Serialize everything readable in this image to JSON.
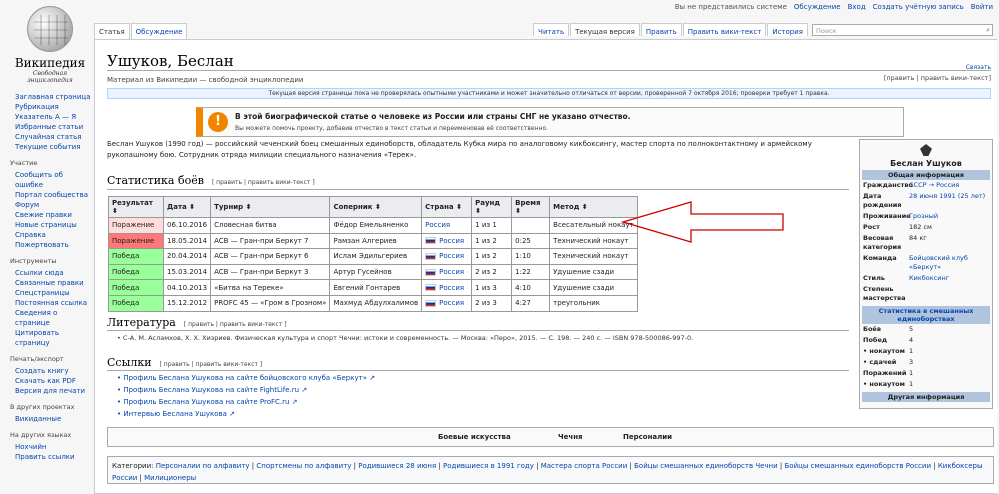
{
  "personal": [
    "Вы не представились системе",
    "Обсуждение",
    "Вход",
    "Создать учётную запись",
    "Войти"
  ],
  "logo": {
    "title": "Википедия",
    "subtitle": "Свободная энциклопедия"
  },
  "sidebar": [
    {
      "head": "",
      "items": [
        "Заглавная страница",
        "Рубрикация",
        "Указатель А — Я",
        "Избранные статьи",
        "Случайная статья",
        "Текущие события"
      ]
    },
    {
      "head": "Участие",
      "items": [
        "Сообщить об ошибке",
        "Портал сообщества",
        "Форум",
        "Свежие правки",
        "Новые страницы",
        "Справка",
        "Пожертвовать"
      ]
    },
    {
      "head": "Инструменты",
      "items": [
        "Ссылки сюда",
        "Связанные правки",
        "Спецстраницы",
        "Постоянная ссылка",
        "Сведения о странице",
        "Цитировать страницу"
      ]
    },
    {
      "head": "Печать/экспорт",
      "items": [
        "Создать книгу",
        "Скачать как PDF",
        "Версия для печати"
      ]
    },
    {
      "head": "В других проектах",
      "items": [
        "Викиданные"
      ]
    },
    {
      "head": "На других языках",
      "items": [
        "Нохчийн",
        "Править ссылки"
      ]
    }
  ],
  "tabs_left": [
    "Статья",
    "Обсуждение"
  ],
  "tabs_right": [
    "Читать",
    "Текущая версия",
    "Править",
    "Править вики-текст",
    "История"
  ],
  "search_placeholder": "Поиск",
  "page": {
    "title": "Ушуков, Беслан",
    "watch": "Связать",
    "from": "Материал из Википедии — свободной энциклопедии",
    "edit_links": "[править | править вики-текст]",
    "rev_notice": "Текущая версия страницы пока не проверялась опытными участниками и может значительно отличаться от версии, проверенной 7 октября 2016; проверки требует 1 правка.",
    "ambox_title": "В этой биографической статье о человеке из России или страны СНГ не указано отчество.",
    "ambox_text": "Вы можете помочь проекту, добавив отчество в текст статьи и переименовав её соответственно.",
    "lead": "Беслан Ушуков (1990 год) — российский чеченский боец смешанных единоборств, обладатель Кубка мира по аналоговому кикбоксингу, мастер спорта по полноконтактному и армейскому рукопашному бою. Сотрудник отряда милиции специального назначения «Терек»."
  },
  "sections": {
    "stats": "Статистика боёв",
    "lit": "Литература",
    "links": "Ссылки",
    "edit": "[ править | править вики-текст ]"
  },
  "fights": {
    "headers": [
      "Результат",
      "Дата",
      "Турнир",
      "Соперник",
      "Страна",
      "Раунд",
      "Время",
      "Метод"
    ],
    "rows": [
      {
        "res": "Поражение",
        "date": "06.10.2016",
        "event": "Словесная битва",
        "opp": "Фёдор Емельяненко",
        "country": "Россия",
        "round": "1 из 1",
        "time": "",
        "method": "Всесательный нокаут",
        "cls": "res-loss",
        "flag": false
      },
      {
        "res": "Поражение",
        "date": "18.05.2014",
        "event": "ACB — Гран-при Беркут 7",
        "opp": "Рамзан Алгериев",
        "country": "Россия",
        "round": "1 из 2",
        "time": "0:25",
        "method": "Технический нокаут",
        "cls": "res-loss-red",
        "flag": true
      },
      {
        "res": "Победа",
        "date": "20.04.2014",
        "event": "ACB — Гран-при Беркут 6",
        "opp": "Ислам Эдильгериев",
        "country": "Россия",
        "round": "1 из 2",
        "time": "1:10",
        "method": "Технический нокаут",
        "cls": "res-win",
        "flag": true
      },
      {
        "res": "Победа",
        "date": "15.03.2014",
        "event": "ACB — Гран-при Беркут 3",
        "opp": "Артур Гусейнов",
        "country": "Россия",
        "round": "2 из 2",
        "time": "1:22",
        "method": "Удушение сзади",
        "cls": "res-win",
        "flag": true
      },
      {
        "res": "Победа",
        "date": "04.10.2013",
        "event": "«Битва на Тереке»",
        "opp": "Евгений Гонтарев",
        "country": "Россия",
        "round": "1 из 3",
        "time": "4:10",
        "method": "Удушение сзади",
        "cls": "res-win",
        "flag": true
      },
      {
        "res": "Победа",
        "date": "15.12.2012",
        "event": "PROFC 45 — «Гром в Грозном»",
        "opp": "Махмуд Абдулхалимов",
        "country": "Россия",
        "round": "2 из 3",
        "time": "4:27",
        "method": "треугольник",
        "cls": "res-win",
        "flag": true
      }
    ]
  },
  "literature": "• С-А. М. Асламхов, Х. Х. Хизриев. Физическая культура и спорт Чечни: истоки и современность. — Москва: «Перо», 2015. — С. 198. — 240 с. — ISBN 978-500086-997-0.",
  "links": [
    "Профиль Беслана Ушукова на сайте бойцовского клуба «Беркут»",
    "Профиль Беслана Ушукова на сайте FightLife.ru",
    "Профиль Беслана Ушукова на сайте ProFC.ru",
    "Интервью Беслана Ушукова"
  ],
  "navbox": [
    "Боевые искусства",
    "Чечня",
    "Персоналии"
  ],
  "categories_label": "Категории:",
  "categories": [
    "Персоналии по алфавиту",
    "Спортсмены по алфавиту",
    "Родившиеся 28 июня",
    "Родившиеся в 1991 году",
    "Мастера спорта России",
    "Бойцы смешанных единоборств Чечни",
    "Бойцы смешанных единоборств России",
    "Кикбоксеры России",
    "Милиционеры"
  ],
  "infobox": {
    "name": "Беслан Ушуков",
    "general": "Общая информация",
    "rows": [
      {
        "k": "Гражданство",
        "v": "СССР → Россия",
        "link": true
      },
      {
        "k": "Дата рождения",
        "v": "28 июня 1991 (25 лет)",
        "link": true
      },
      {
        "k": "Проживание",
        "v": "Грозный",
        "link": true
      },
      {
        "k": "Рост",
        "v": "182 см",
        "link": false
      },
      {
        "k": "Весовая категория",
        "v": "84 кг",
        "link": false
      },
      {
        "k": "Команда",
        "v": "Бойцовский клуб «Беркут»",
        "link": true
      },
      {
        "k": "Стиль",
        "v": "Кикбоксинг",
        "link": true
      },
      {
        "k": "Степень мастерства",
        "v": "",
        "link": false
      }
    ],
    "stats_band": "Статистика в смешанных единоборствах",
    "stats": [
      {
        "k": "Боёв",
        "v": "5"
      },
      {
        "k": "Побед",
        "v": "4"
      },
      {
        "k": "• нокаутом",
        "v": "1"
      },
      {
        "k": "• сдачей",
        "v": "3"
      },
      {
        "k": "Поражений",
        "v": "1"
      },
      {
        "k": "• нокаутом",
        "v": "1"
      }
    ],
    "other_band": "Другая информация"
  }
}
